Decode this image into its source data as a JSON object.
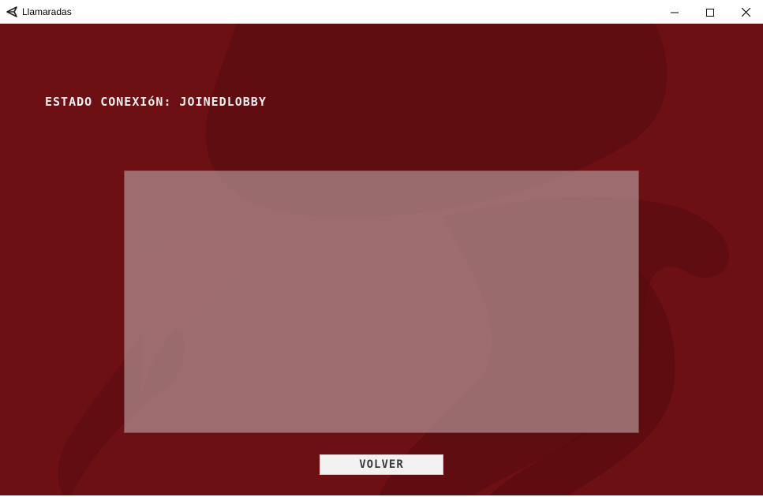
{
  "window": {
    "title": "Llamaradas",
    "app_icon": "unity-icon",
    "controls": {
      "minimize_icon": "minimize-icon",
      "maximize_icon": "maximize-icon",
      "close_icon": "close-icon"
    }
  },
  "game": {
    "status_label": "ESTADO CONEXIóN:",
    "status_value": "JOINEDLOBBY",
    "background_color": "#6b0f13",
    "panel_color": "#8c6062",
    "back_button_label": "VOLVER"
  }
}
